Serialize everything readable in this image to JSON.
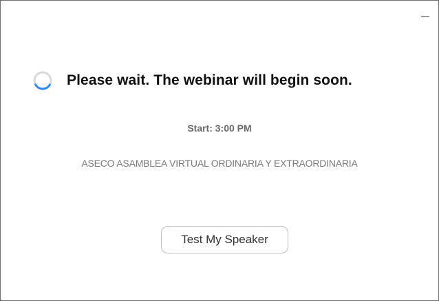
{
  "window": {
    "minimize_icon": "minimize-icon"
  },
  "status": {
    "icon": "loading-spinner-icon",
    "message": "Please wait. The webinar will begin soon."
  },
  "schedule": {
    "start_text": "Start: 3:00 PM"
  },
  "webinar": {
    "title": "ASECO ASAMBLEA VIRTUAL ORDINARIA Y EXTRAORDINARIA"
  },
  "actions": {
    "test_speaker_label": "Test My Speaker"
  },
  "colors": {
    "spinner_track": "#d9d9d9",
    "spinner_arc": "#2d8cff",
    "border": "#6e6e6e"
  }
}
